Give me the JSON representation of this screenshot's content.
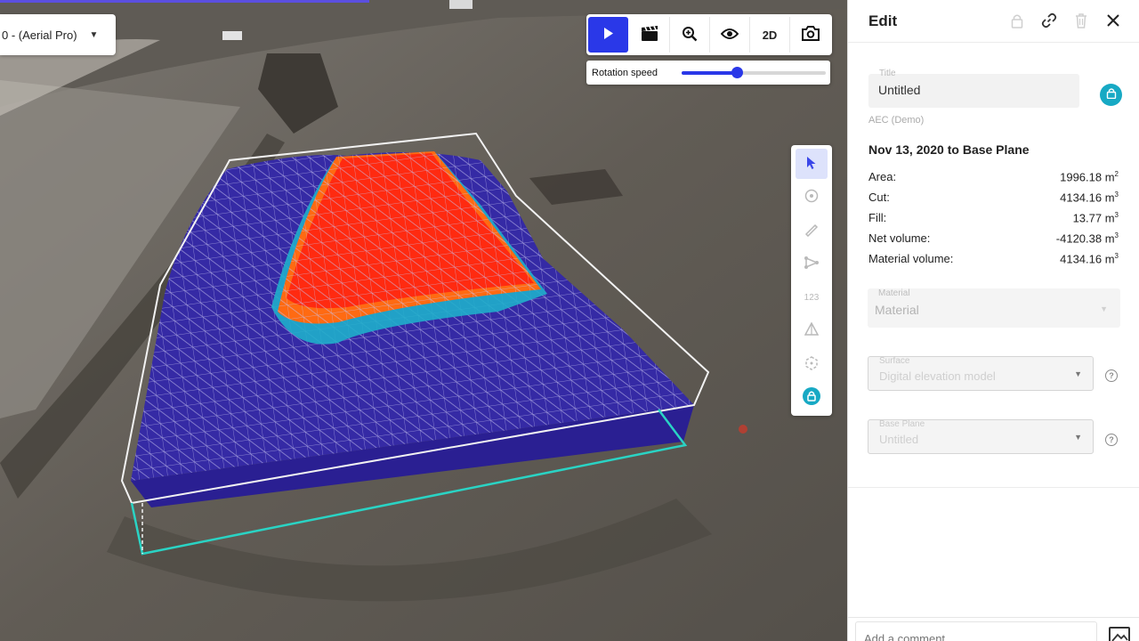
{
  "viewport": {
    "layer_select": {
      "label": "0 - (Aerial Pro)",
      "icon": "caret-down-icon"
    },
    "toolbar": {
      "buttons": [
        {
          "name": "play",
          "icon": "play-icon",
          "active": true
        },
        {
          "name": "animation",
          "icon": "clapperboard-icon"
        },
        {
          "name": "zoom",
          "icon": "zoom-in-icon"
        },
        {
          "name": "visibility",
          "icon": "eye-icon"
        },
        {
          "name": "view-mode",
          "label": "2D"
        },
        {
          "name": "screenshot",
          "icon": "camera-icon"
        }
      ],
      "rotation_speed_label": "Rotation speed",
      "rotation_speed_value": 0.38
    },
    "side_tools": [
      {
        "name": "select",
        "icon": "cursor-icon",
        "active": true
      },
      {
        "name": "point",
        "icon": "location-pin-icon"
      },
      {
        "name": "measure",
        "icon": "ruler-icon"
      },
      {
        "name": "polyline",
        "icon": "polyline-icon"
      },
      {
        "name": "count",
        "label": "123"
      },
      {
        "name": "volume",
        "icon": "volume-cone-icon"
      },
      {
        "name": "object",
        "icon": "cube-icon"
      },
      {
        "name": "lock",
        "icon": "lock-icon"
      }
    ],
    "colors": {
      "accent": "#2a38e8",
      "teal": "#17a9c4",
      "mesh_fill": "#2e2399",
      "cut_red": "#ff2a10",
      "cut_orange": "#ff6a12"
    }
  },
  "panel": {
    "title": "Edit",
    "header_icons": [
      "lock-icon",
      "link-icon",
      "trash-icon",
      "close-icon"
    ],
    "title_field": {
      "label": "Title",
      "value": "Untitled"
    },
    "subtitle": "AEC (Demo)",
    "range_title": "Nov 13, 2020 to Base Plane",
    "stats": [
      {
        "label": "Area:",
        "value": "1996.18 m",
        "sup": "2"
      },
      {
        "label": "Cut:",
        "value": "4134.16 m",
        "sup": "3"
      },
      {
        "label": "Fill:",
        "value": "13.77 m",
        "sup": "3"
      },
      {
        "label": "Net volume:",
        "value": "-4120.38 m",
        "sup": "3"
      },
      {
        "label": "Material volume:",
        "value": "4134.16 m",
        "sup": "3"
      }
    ],
    "material": {
      "label": "Material",
      "value": "Material"
    },
    "surface": {
      "label": "Surface",
      "value": "Digital elevation model"
    },
    "base_plane": {
      "label": "Base Plane",
      "value": "Untitled"
    },
    "comment_placeholder": "Add a comment..."
  }
}
